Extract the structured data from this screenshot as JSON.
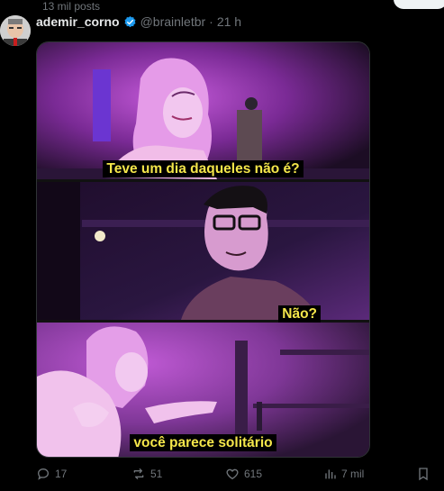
{
  "top": {
    "posts_count": "13 mil posts"
  },
  "post": {
    "author_name": "ademir_corno",
    "handle": "@brainletbr",
    "separator": "·",
    "time": "21 h"
  },
  "comic": {
    "caption_1": "Teve um dia daqueles não é?",
    "caption_2": "Não?",
    "caption_3": "você parece solitário"
  },
  "actions": {
    "replies": "17",
    "reposts": "51",
    "likes": "615",
    "views": "7 mil"
  },
  "colors": {
    "accent": "#1d9bf0",
    "caption_text": "#f4e64a",
    "panel_purple": "#8a3db0"
  }
}
